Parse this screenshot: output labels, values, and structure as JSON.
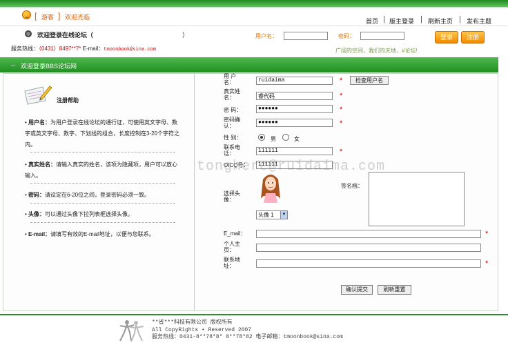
{
  "top": {
    "bracket_open": "[",
    "guest": "游客",
    "bracket_close": "]",
    "welcome": "欢迎光临"
  },
  "nav": {
    "home": "首页",
    "login": "版主登录",
    "refresh": "刷新主页",
    "post": "发布主题",
    "sep": "|"
  },
  "header": {
    "welcome_title": "欢迎登录在线论坛（",
    "paren_close": "）",
    "hotline_label": "服务热线：",
    "hotline_number": "（0431）8497**7*",
    "email_label": "E-mail：",
    "email": "tmoonbook@sina.com",
    "username_label": "用户名：",
    "password_label": "密码：",
    "login_button": "登录",
    "register_button": "注册",
    "slogan": "广阔的空间，我们的天地，#论坛!"
  },
  "section": {
    "arrow": "→",
    "title": "欢迎登录BBS论坛网"
  },
  "help": {
    "title": "注册帮助",
    "items": [
      {
        "bullet": "•",
        "label": "用户名：",
        "text": "为用户登录在线论坛的通行证，可使用英文字母、数字或英文字母、数字、下划线的组合，长度控制在3-20个字符之内。"
      },
      {
        "bullet": "•",
        "label": "真实姓名：",
        "text": "请输入真实的姓名，该项为隐藏项，用户可以放心输入。"
      },
      {
        "bullet": "•",
        "label": "密码：",
        "text": "请设定在6-20位之间，登录密码必须一致。"
      },
      {
        "bullet": "•",
        "label": "头像：",
        "text": "可以通过头像下拉列表框选择头像。"
      },
      {
        "bullet": "•",
        "label": "E-mail：",
        "text": "请填写有效的E-mail地址，以便与您联系。"
      }
    ]
  },
  "form": {
    "username_label": "用 户 名：",
    "username_value": "ruidaima",
    "check_button": "检查用户名",
    "realname_label": "真实姓名：",
    "realname_value": "睿代码",
    "password_label": "密  码：",
    "password_value": "●●●●●●",
    "confirm_label": "密码确认：",
    "confirm_value": "●●●●●●",
    "gender_label": "性  别：",
    "male": "男",
    "female": "女",
    "phone_label": "联系电话：",
    "phone_value": "111111",
    "oicq_label": "OICQ号：",
    "oicq_value": "111111",
    "avatar_label": "选择头像：",
    "avatar_select": "头像 1",
    "signature_label": "签名档：",
    "email_label": "E_mail：",
    "homepage_label": "个人主页：",
    "address_label": "联系地址：",
    "submit_button": "确认提交",
    "reset_button": "刷新重置",
    "star": "*"
  },
  "footer": {
    "line1": "**省***科技有限公司 版权所有",
    "line2": "All CopyRights • Reserved 2007",
    "line3": "服务热线：0431-8**78*8* 8**78*82  电子邮箱：tmoonbook@sina.com"
  },
  "watermark": "tonghere@ruidaima.com",
  "colors": {
    "brand_green": "#2f9a2f",
    "accent_orange": "#f08a00",
    "required_red": "#cc0000"
  }
}
